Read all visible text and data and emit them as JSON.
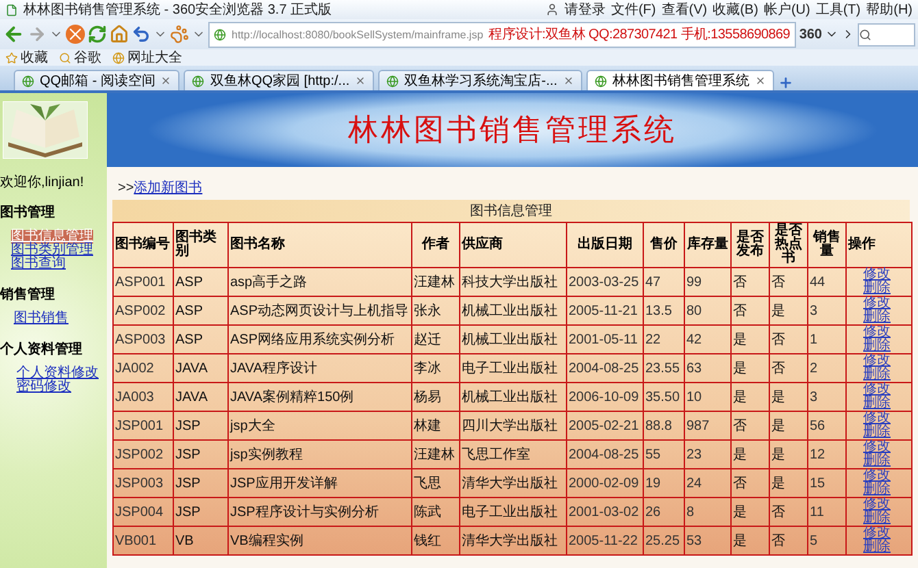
{
  "browser": {
    "title": "林林图书销售管理系统 - 360安全浏览器 3.7 正式版",
    "login": "请登录",
    "menu": [
      "文件(F)",
      "查看(V)",
      "收藏(B)",
      "帐户(U)",
      "工具(T)",
      "帮助(H)"
    ],
    "address": "http://localhost:8080/bookSellSystem/mainframe.jsp",
    "address_note": "程序设计:双鱼林 QQ:287307421 手机:13558690869",
    "badge": "360"
  },
  "bookmarks": [
    {
      "label": "收藏",
      "kind": "favorites"
    },
    {
      "label": "谷歌",
      "kind": "search"
    },
    {
      "label": "网址大全",
      "kind": "sites"
    }
  ],
  "tabs": [
    {
      "label": "QQ邮箱 - 阅读空间",
      "selected": false
    },
    {
      "label": "双鱼林QQ家园 [http:/...",
      "selected": false
    },
    {
      "label": "双鱼林学习系统淘宝店-...",
      "selected": false
    },
    {
      "label": "林林图书销售管理系统",
      "selected": true
    }
  ],
  "app": {
    "title": "林林图书销售管理系统",
    "welcome": "欢迎你,linjian!",
    "sidebar": [
      {
        "heading": "图书管理",
        "items": [
          {
            "label": "图书信息管理",
            "selected": true
          },
          {
            "label": "图书类别管理",
            "selected": false
          },
          {
            "label": "图书查询",
            "selected": false
          }
        ]
      },
      {
        "heading": "销售管理",
        "items": [
          {
            "label": "图书销售",
            "selected": false
          }
        ]
      },
      {
        "heading": "个人资料管理",
        "items": [
          {
            "label": "个人资料修改",
            "selected": false
          },
          {
            "label": "密码修改",
            "selected": false
          }
        ]
      }
    ],
    "add_link_prefix": ">>",
    "add_link": "添加新图书",
    "table": {
      "caption": "图书信息管理",
      "columns": [
        "图书编号",
        "图书类别",
        "图书名称",
        "作者",
        "供应商",
        "出版日期",
        "售价",
        "库存量",
        "是否发布",
        "是否热点书",
        "销售量",
        "操作"
      ],
      "rows": [
        {
          "cells": [
            "ASP001",
            "ASP",
            "asp高手之路",
            "汪建林",
            "科技大学出版社",
            "2003-03-25",
            "47",
            "99",
            "否",
            "否",
            "44"
          ],
          "actions": [
            "修改",
            "删除"
          ]
        },
        {
          "cells": [
            "ASP002",
            "ASP",
            "ASP动态网页设计与上机指导",
            "张永",
            "机械工业出版社",
            "2005-11-21",
            "13.5",
            "80",
            "否",
            "是",
            "3"
          ],
          "actions": [
            "修改",
            "删除"
          ]
        },
        {
          "cells": [
            "ASP003",
            "ASP",
            "ASP网络应用系统实例分析",
            "赵迁",
            "机械工业出版社",
            "2001-05-11",
            "22",
            "42",
            "是",
            "否",
            "1"
          ],
          "actions": [
            "修改",
            "删除"
          ]
        },
        {
          "cells": [
            "JA002",
            "JAVA",
            "JAVA程序设计",
            "李冰",
            "电子工业出版社",
            "2004-08-25",
            "23.55",
            "63",
            "是",
            "否",
            "2"
          ],
          "actions": [
            "修改",
            "删除"
          ]
        },
        {
          "cells": [
            "JA003",
            "JAVA",
            "JAVA案例精粹150例",
            "杨易",
            "机械工业出版社",
            "2006-10-09",
            "35.50",
            "10",
            "是",
            "是",
            "3"
          ],
          "actions": [
            "修改",
            "删除"
          ]
        },
        {
          "cells": [
            "JSP001",
            "JSP",
            "jsp大全",
            "林建",
            "四川大学出版社",
            "2005-02-21",
            "88.8",
            "987",
            "否",
            "是",
            "56"
          ],
          "actions": [
            "修改",
            "删除"
          ]
        },
        {
          "cells": [
            "JSP002",
            "JSP",
            "jsp实例教程",
            "汪建林",
            "飞思工作室",
            "2004-08-25",
            "55",
            "23",
            "是",
            "是",
            "12"
          ],
          "actions": [
            "修改",
            "删除"
          ]
        },
        {
          "cells": [
            "JSP003",
            "JSP",
            "JSP应用开发详解",
            "飞思",
            "清华大学出版社",
            "2000-02-09",
            "19",
            "24",
            "否",
            "是",
            "15"
          ],
          "actions": [
            "修改",
            "删除"
          ]
        },
        {
          "cells": [
            "JSP004",
            "JSP",
            "JSP程序设计与实例分析",
            "陈武",
            "电子工业出版社",
            "2001-03-02",
            "26",
            "8",
            "是",
            "否",
            "11"
          ],
          "actions": [
            "修改",
            "删除"
          ]
        },
        {
          "cells": [
            "VB001",
            "VB",
            "VB编程实例",
            "钱红",
            "清华大学出版社",
            "2005-11-22",
            "25.25",
            "53",
            "是",
            "否",
            "5"
          ],
          "actions": [
            "修改",
            "删除"
          ]
        }
      ]
    }
  }
}
